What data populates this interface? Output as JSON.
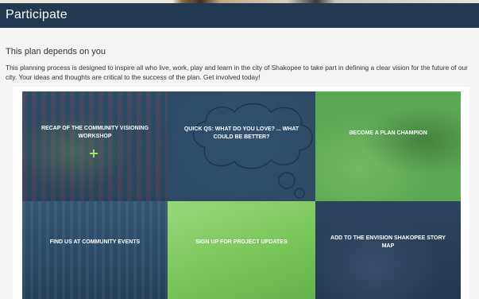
{
  "header": {
    "title": "Participate"
  },
  "intro": {
    "subheading": "This plan depends on you",
    "body": "This planning process is designed to inspire all who live, work, play and learn in the city of Shakopee to take part in defining a clear vision for the future of our city. Your ideas and thoughts are critical to the success of the plan. Get involved today!"
  },
  "tiles": [
    {
      "label": "RECAP OF THE COMMUNITY VISIONING WORKSHOP",
      "icon": "plus-icon"
    },
    {
      "label": "QUICK QS: WHAT DO YOU LOVE? ... WHAT COULD BE BETTER?",
      "icon": "thought-bubble-icon"
    },
    {
      "label": "BECOME A PLAN CHAMPION"
    },
    {
      "label": "FIND US AT COMMUNITY EVENTS"
    },
    {
      "label": "SIGN UP FOR PROJECT UPDATES"
    },
    {
      "label": "ADD TO THE ENVISION SHAKOPEE STORY MAP"
    }
  ],
  "colors": {
    "header_bg": "#223951",
    "tile_navy": "#2b4660",
    "tile_green": "#5aa852",
    "tile_light_green": "#7ecb5c",
    "page_bg": "#f4f4f4"
  }
}
